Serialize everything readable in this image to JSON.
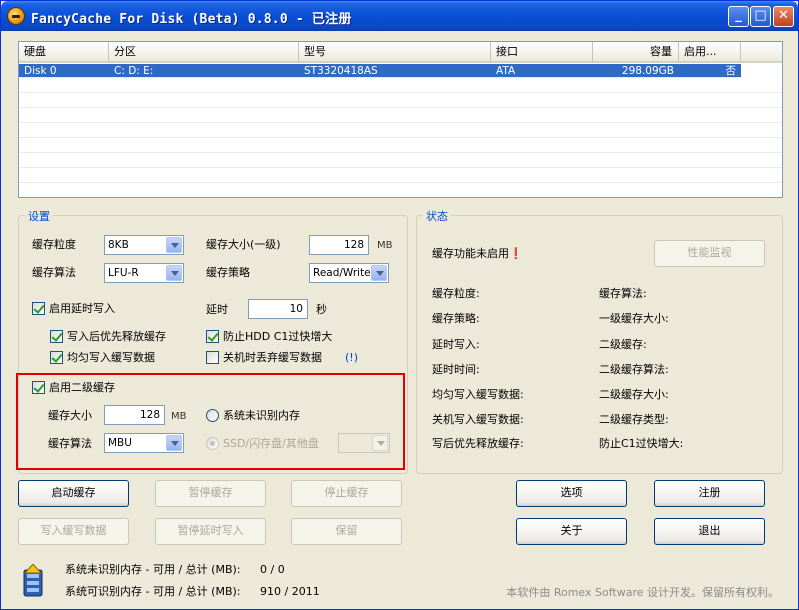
{
  "window": {
    "title": "FancyCache For Disk (Beta) 0.8.0 - 已注册",
    "controls": {
      "minimize": "_",
      "maximize": "□",
      "close": "✕"
    }
  },
  "disk_list": {
    "columns": [
      "硬盘",
      "分区",
      "型号",
      "接口",
      "容量",
      "启用..."
    ],
    "rows": [
      {
        "disk": "Disk 0",
        "partitions": "C: D: E:",
        "model": "ST3320418AS",
        "interface": "ATA",
        "capacity": "298.09GB",
        "enabled": "否"
      }
    ]
  },
  "settings": {
    "group_title": "设置",
    "granularity_label": "缓存粒度",
    "granularity_value": "8KB",
    "algorithm_label": "缓存算法",
    "algorithm_value": "LFU-R",
    "l1_size_label": "缓存大小(一级)",
    "l1_size_value": "128",
    "l1_size_unit": "MB",
    "strategy_label": "缓存策略",
    "strategy_value": "Read/Write",
    "delayed_write_label": "启用延时写入",
    "delay_label": "延时",
    "delay_value": "10",
    "delay_unit": "秒",
    "free_after_write_label": "写入后优先释放缓存",
    "prevent_c1_label": "防止HDD C1过快增大",
    "balance_write_label": "均匀写入缓写数据",
    "discard_on_shutdown_label": "关机时丢弃缓写数据",
    "help_link": "(!)",
    "l2_enable_label": "启用二级缓存",
    "l2_size_label": "缓存大小",
    "l2_size_value": "128",
    "l2_size_unit": "MB",
    "l2_algorithm_label": "缓存算法",
    "l2_algorithm_value": "MBU",
    "l2_unrecognized_mem_label": "系统未识别内存",
    "l2_ssd_label": "SSD/闪存盘/其他盘"
  },
  "status": {
    "group_title": "状态",
    "state_text": "缓存功能未启用❗",
    "monitor_button": "性能监视",
    "labels_left": [
      "缓存粒度:",
      "缓存策略:",
      "延时写入:",
      "延时时间:",
      "均匀写入缓写数据:",
      "关机写入缓写数据:",
      "写后优先释放缓存:"
    ],
    "labels_right": [
      "缓存算法:",
      "一级缓存大小:",
      "二级缓存:",
      "二级缓存算法:",
      "二级缓存大小:",
      "二级缓存类型:",
      "防止C1过快增大:"
    ]
  },
  "buttons": {
    "start": "启动缓存",
    "pause": "暂停缓存",
    "stop": "停止缓存",
    "write_data": "写入缓写数据",
    "pause_delay": "暂停延时写入",
    "reserve": "保留",
    "options": "选项",
    "register": "注册",
    "about": "关于",
    "exit": "退出"
  },
  "footer": {
    "unrecognized_mem_label": "系统未识别内存 - 可用 / 总计 (MB):",
    "unrecognized_mem_value": "0 / 0",
    "recognized_mem_label": "系统可识别内存 - 可用 / 总计 (MB):",
    "recognized_mem_value": "910 / 2011",
    "copyright": "本软件由 Romex Software 设计开发。保留所有权利。"
  }
}
